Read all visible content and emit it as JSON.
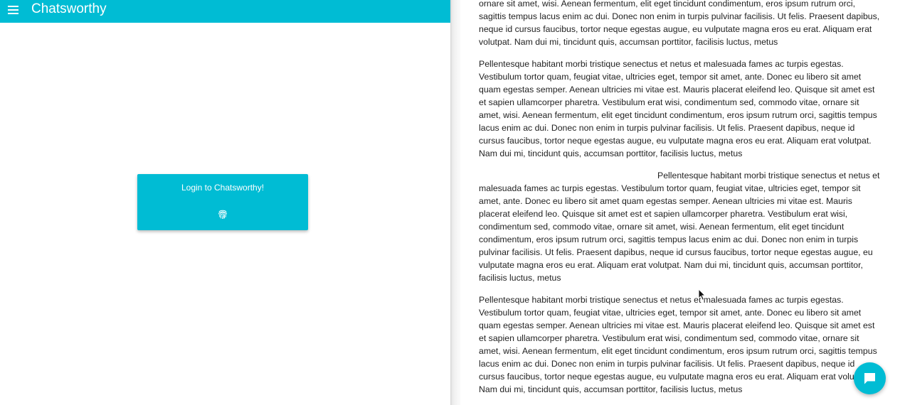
{
  "app_bar": {
    "title": "Chatsworthy",
    "menu_icon": "menu-icon",
    "color": "#00bcd4"
  },
  "login_card": {
    "label": "Login to Chatsworthy!",
    "icon": "fingerprint-icon"
  },
  "article": {
    "paragraphs": [
      "ornare sit amet, wisi. Aenean fermentum, elit eget tincidunt condimentum, eros ipsum rutrum orci, sagittis tempus lacus enim ac dui. Donec non enim in turpis pulvinar facilisis. Ut felis. Praesent dapibus, neque id cursus faucibus, tortor neque egestas augue, eu vulputate magna eros eu erat. Aliquam erat volutpat. Nam dui mi, tincidunt quis, accumsan porttitor, facilisis luctus, metus",
      "Pellentesque habitant morbi tristique senectus et netus et malesuada fames ac turpis egestas. Vestibulum tortor quam, feugiat vitae, ultricies eget, tempor sit amet, ante. Donec eu libero sit amet quam egestas semper. Aenean ultricies mi vitae est. Mauris placerat eleifend leo. Quisque sit amet est et sapien ullamcorper pharetra. Vestibulum erat wisi, condimentum sed, commodo vitae, ornare sit amet, wisi. Aenean fermentum, elit eget tincidunt condimentum, eros ipsum rutrum orci, sagittis tempus lacus enim ac dui. Donec non enim in turpis pulvinar facilisis. Ut felis. Praesent dapibus, neque id cursus faucibus, tortor neque egestas augue, eu vulputate magna eros eu erat. Aliquam erat volutpat. Nam dui mi, tincidunt quis, accumsan porttitor, facilisis luctus, metus",
      "Pellentesque habitant morbi tristique senectus et netus et malesuada fames ac turpis egestas. Vestibulum tortor quam, feugiat vitae, ultricies eget, tempor sit amet, ante. Donec eu libero sit amet quam egestas semper. Aenean ultricies mi vitae est. Mauris placerat eleifend leo. Quisque sit amet est et sapien ullamcorper pharetra. Vestibulum erat wisi, condimentum sed, commodo vitae, ornare sit amet, wisi. Aenean fermentum, elit eget tincidunt condimentum, eros ipsum rutrum orci, sagittis tempus lacus enim ac dui. Donec non enim in turpis pulvinar facilisis. Ut felis. Praesent dapibus, neque id cursus faucibus, tortor neque egestas augue, eu vulputate magna eros eu erat. Aliquam erat volutpat. Nam dui mi, tincidunt quis, accumsan porttitor, facilisis luctus, metus",
      "Pellentesque habitant morbi tristique senectus et netus et malesuada fames ac turpis egestas. Vestibulum tortor quam, feugiat vitae, ultricies eget, tempor sit amet, ante. Donec eu libero sit amet quam egestas semper. Aenean ultricies mi vitae est. Mauris placerat eleifend leo. Quisque sit amet est et sapien ullamcorper pharetra. Vestibulum erat wisi, condimentum sed, commodo vitae, ornare sit amet, wisi. Aenean fermentum, elit eget tincidunt condimentum, eros ipsum rutrum orci, sagittis tempus lacus enim ac dui. Donec non enim in turpis pulvinar facilisis. Ut felis. Praesent dapibus, neque id cursus faucibus, tortor neque egestas augue, eu vulputate magna eros eu erat. Aliquam erat volutpat. Nam dui mi, tincidunt quis, accumsan porttitor, facilisis luctus, metus"
    ]
  },
  "chat_fab": {
    "icon": "chat-bubble-icon"
  },
  "cursor": {
    "icon": "mouse-pointer-icon"
  }
}
